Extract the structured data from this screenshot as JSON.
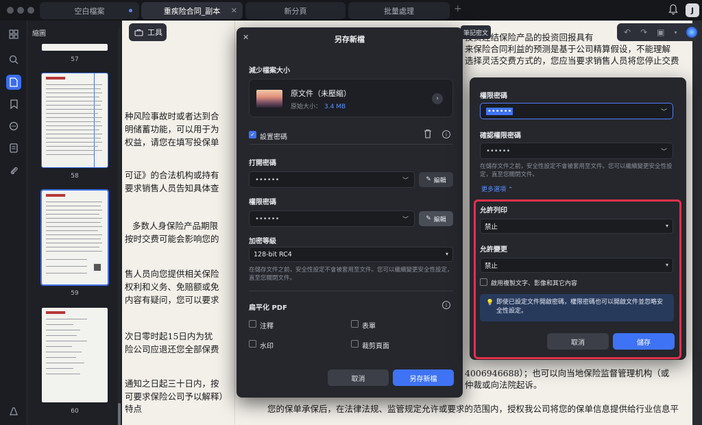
{
  "tabs": [
    {
      "label": "空白檔案",
      "has_dot": true
    },
    {
      "label": "重疾险合同_副本",
      "active": true
    },
    {
      "label": "新分頁"
    },
    {
      "label": "批量處理"
    }
  ],
  "user_initial": "J",
  "sidebar": {
    "title": "縮圖",
    "pages": [
      "57",
      "58",
      "59",
      "60"
    ]
  },
  "toolbar": {
    "tools_label": "工具",
    "annotation_label": "筆記密文"
  },
  "document": {
    "left_lines": [
      "种风险事故时或者达到合",
      "明储蓄功能，可以用于为",
      "权益，请您在填写投保单",
      "可证》的合法机构或持有",
      "要求销售人员告知具体查",
      "多数人身保险产品期限",
      "按时交费可能会影响您的",
      "售人员向您提供相关保险",
      "权利和义务、免赔额或免",
      "内容有疑问，您可以要求",
      "次日零时起15日内为犹",
      "险公司应退还您全部保费",
      "通知之日起三十日内，按",
      "可要求保险公司予以解释）",
      "特点"
    ],
    "right_top_lines": [
      "投资连结保险产品的投资回报具有",
      "来保险合同利益的预测是基于公司精算假设，不能理解",
      "选择灵活交费方式的，您应当要求销售人员将您停止交费"
    ],
    "right_bottom_lines": [
      "4006946688）；也可以向当地保险监督管理机构（或",
      "仲裁或向法院起诉。",
      "您的保单承保后，在法律法规、监管规定允许或要求的范围内，授权我公司将您的保单信息提供给行业信息平"
    ]
  },
  "save_dialog": {
    "title": "另存新檔",
    "reduce_size_label": "減少檔案大小",
    "file_name": "原文件（未壓縮）",
    "original_size_label": "原始大小：",
    "original_size_value": "3.4 MB",
    "set_password_label": "設置密碼",
    "set_password_checked": true,
    "open_password_label": "打開密碼",
    "open_password_value": "••••••",
    "permission_password_label": "權限密碼",
    "permission_password_value": "••••••",
    "edit_label": "編輯",
    "encryption_level_label": "加密等級",
    "encryption_level_value": "128-bit RC4",
    "encryption_hint": "在儲存文件之前，安全性設定不會被套用至文件。您可以繼續變更安全性設定，直至您關閉文件。",
    "flatten_label": "扁平化 PDF",
    "flatten_options": [
      "注釋",
      "表單",
      "水印",
      "裁剪頁面"
    ],
    "cancel_label": "取消",
    "save_as_label": "另存新檔"
  },
  "permissions_panel": {
    "permission_password_label": "權限密碼",
    "permission_password_value": "••••••",
    "confirm_password_label": "確認權限密碼",
    "confirm_password_value": "••••••",
    "hint": "在儲存文件之前，安全性設定不會被套用至文件。您可以繼續變更安全性設定，直至您關閉文件。",
    "more_options_label": "更多選項 ⌃",
    "allow_print_label": "允許列印",
    "allow_print_value": "禁止",
    "allow_change_label": "允許變更",
    "allow_change_value": "禁止",
    "enable_copy_label": "啟用複製文字、影像和其它內容",
    "enable_copy_checked": false,
    "notice": "即使已設定文件開啟密碼，權限密碼也可以開啟文件並忽略安全性設定。",
    "cancel_label": "取消",
    "save_label": "儲存"
  },
  "colors": {
    "accent": "#3f73f5",
    "highlight": "#e5304b",
    "link": "#5a8fff"
  }
}
